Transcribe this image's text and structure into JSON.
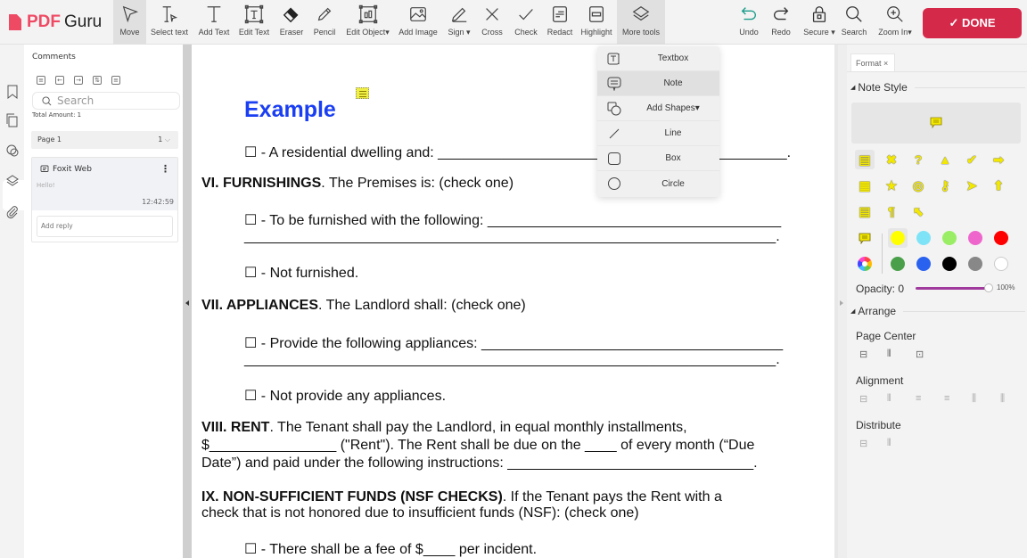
{
  "app": {
    "logo_pdf": "PDF",
    "logo_guru": "Guru"
  },
  "toolbar": {
    "tools": [
      {
        "label": "Move",
        "icon": "cursor-arrow-icon",
        "active": true
      },
      {
        "label": "Select text",
        "icon": "select-text-icon"
      },
      {
        "label": "Add Text",
        "icon": "text-t-icon"
      },
      {
        "label": "Edit Text",
        "icon": "edit-text-icon"
      },
      {
        "label": "Eraser",
        "icon": "eraser-icon"
      },
      {
        "label": "Pencil",
        "icon": "pencil-icon"
      },
      {
        "label": "Edit Object▾",
        "icon": "edit-object-icon"
      },
      {
        "label": "Add Image",
        "icon": "image-icon"
      },
      {
        "label": "Sign ▾",
        "icon": "sign-pen-icon"
      },
      {
        "label": "Cross",
        "icon": "cross-icon"
      },
      {
        "label": "Check",
        "icon": "check-icon"
      },
      {
        "label": "Redact",
        "icon": "redact-icon"
      },
      {
        "label": "Highlight",
        "icon": "highlight-icon"
      },
      {
        "label": "More tools",
        "icon": "layers-icon",
        "active": true
      }
    ],
    "right_tools": [
      {
        "label": "Undo",
        "icon": "undo-icon"
      },
      {
        "label": "Redo",
        "icon": "redo-icon"
      },
      {
        "label": "Secure ▾",
        "icon": "lock-icon"
      },
      {
        "label": "Search",
        "icon": "search-icon"
      },
      {
        "label": "Zoom In▾",
        "icon": "zoom-in-icon"
      }
    ],
    "done_label": "✓ DONE",
    "accent_color": "#d5294a"
  },
  "comments": {
    "title": "Comments",
    "search_placeholder": "Search",
    "total": "Total Amount: 1",
    "page_label": "Page 1",
    "page_count": "1",
    "items": [
      {
        "author": "Foxit Web",
        "message": "Hello!",
        "time": "12:42:59",
        "reply_placeholder": "Add reply"
      }
    ]
  },
  "document": {
    "heading": "Example",
    "lines": [
      {
        "text": "☐ - A residential dwelling and: ____________________________________________.",
        "bold": ""
      },
      {
        "bold": "VI. FURNISHINGS",
        "text": ". The Premises is: (check one)"
      },
      {
        "text": "☐ - To be furnished with the following: _____________________________________",
        "bold": ""
      },
      {
        "text": "___________________________________________________________________.",
        "bold": ""
      },
      {
        "text": "☐ - Not furnished.",
        "bold": ""
      },
      {
        "bold": "VII. APPLIANCES",
        "text": ". The Landlord shall: (check one)"
      },
      {
        "text": "☐ - Provide the following appliances: ______________________________________",
        "bold": ""
      },
      {
        "text": "___________________________________________________________________.",
        "bold": ""
      },
      {
        "text": "☐ - Not provide any appliances.",
        "bold": ""
      },
      {
        "bold": "VIII. RENT",
        "text": ". The Tenant shall pay the Landlord, in equal monthly installments,"
      },
      {
        "text": "$________________ (\"Rent\"). The Rent shall be due on the ____ of every month (“Due",
        "bold": ""
      },
      {
        "text": "Date”) and paid under the following instructions: _______________________________.",
        "bold": ""
      },
      {
        "bold": "IX. NON-SUFFICIENT FUNDS (NSF CHECKS)",
        "text": ". If the Tenant pays the Rent with a"
      },
      {
        "text": "check that is not honored due to insufficient funds (NSF): (check one)",
        "bold": ""
      },
      {
        "text": "☐ - There shall be a fee of $____ per incident.",
        "bold": ""
      }
    ]
  },
  "more_tools_menu": {
    "items": [
      {
        "label": "Textbox",
        "icon": "textbox-icon"
      },
      {
        "label": "Note",
        "icon": "note-icon",
        "highlighted": true
      },
      {
        "label": "Add Shapes▾",
        "icon": "shapes-icon"
      },
      {
        "label": "Line",
        "icon": "line-icon"
      },
      {
        "label": "Box",
        "icon": "box-icon"
      },
      {
        "label": "Circle",
        "icon": "circle-icon"
      }
    ]
  },
  "format_panel": {
    "tab_label": "Format ×",
    "note_style_label": "Note Style",
    "note_icons": [
      "comment",
      "cross",
      "help",
      "triangle",
      "check",
      "right-arrow",
      "paperclip-stack",
      "star",
      "circle",
      "key",
      "right-pointer",
      "up-arrow",
      "note",
      "paragraph",
      "up-left-arrow"
    ],
    "colors_row1": [
      "#ffff00",
      "#7fe3f7",
      "#99ee66",
      "#ee66cc",
      "#ff0000"
    ],
    "colors_row2": [
      "#4aa04a",
      "#2a62f0",
      "#000000",
      "#888888",
      "#ffffff"
    ],
    "selected_color": "#ffff00",
    "opacity_label": "Opacity:",
    "opacity_min": "0",
    "opacity_value": "100%",
    "arrange_label": "Arrange",
    "page_center_label": "Page Center",
    "alignment_label": "Alignment",
    "distribute_label": "Distribute"
  }
}
